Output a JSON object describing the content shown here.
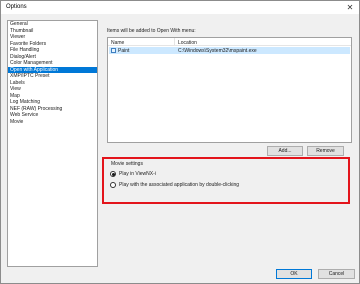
{
  "window": {
    "title": "Options"
  },
  "sidebar": {
    "items": [
      {
        "label": "General",
        "selected": false
      },
      {
        "label": "Thumbnail",
        "selected": false
      },
      {
        "label": "Viewer",
        "selected": false
      },
      {
        "label": "Favorite Folders",
        "selected": false
      },
      {
        "label": "File Handling",
        "selected": false
      },
      {
        "label": "Dialog/Alert",
        "selected": false
      },
      {
        "label": "Color Management",
        "selected": false
      },
      {
        "label": "Open with Application",
        "selected": true
      },
      {
        "label": "XMP/IPTC Preset",
        "selected": false
      },
      {
        "label": "Labels",
        "selected": false
      },
      {
        "label": "View",
        "selected": false
      },
      {
        "label": "Map",
        "selected": false
      },
      {
        "label": "Log Matching",
        "selected": false
      },
      {
        "label": "NEF (RAW) Processing",
        "selected": false
      },
      {
        "label": "Web Service",
        "selected": false
      },
      {
        "label": "Movie",
        "selected": false
      }
    ]
  },
  "open_with": {
    "caption": "Items will be added to Open With menu:",
    "columns": [
      "Name",
      "Location"
    ],
    "rows": [
      {
        "name": "Paint",
        "location": "C:\\Windows\\System32\\mspaint.exe"
      }
    ],
    "add_label": "Add...",
    "remove_label": "Remove"
  },
  "movie_settings": {
    "title": "Movie settings",
    "options": [
      {
        "label": "Play in ViewNX-i",
        "checked": true
      },
      {
        "label": "Play with the associated application by double-clicking",
        "checked": false
      }
    ]
  },
  "footer": {
    "ok_label": "OK",
    "cancel_label": "Cancel"
  },
  "colors": {
    "selection": "#0078d7",
    "row_highlight": "#cce8ff",
    "annotation_border": "#e3141b"
  }
}
